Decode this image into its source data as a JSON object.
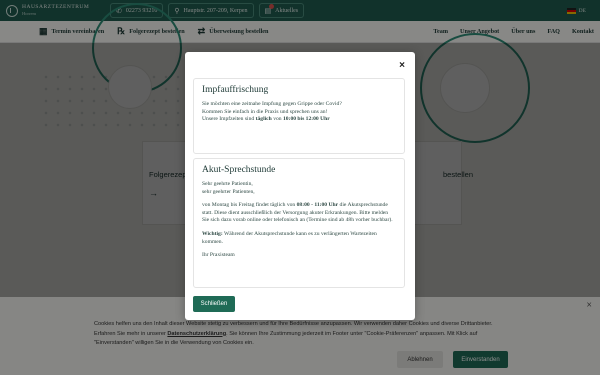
{
  "topbar": {
    "logo_main": "HAUSARZTEZENTRUM",
    "logo_sub": "Horrem",
    "phone": "02273 93210",
    "address": "Hauptstr. 207-209, Kerpen",
    "news": "Aktuelles",
    "lang": "DE"
  },
  "nav": {
    "items": [
      {
        "label": "Termin vereinbaren",
        "icon": "calendar-icon"
      },
      {
        "label": "Folgerezept bestellen",
        "icon": "prescription-icon"
      },
      {
        "label": "Überweisung bestellen",
        "icon": "referral-icon"
      }
    ],
    "right": [
      "Team",
      "Unser Angebot",
      "Über uns",
      "FAQ",
      "Kontakt"
    ]
  },
  "hero": {
    "card_left": "Folgerezep",
    "card_right": "bestellen",
    "arrow": "→"
  },
  "modal": {
    "close": "×",
    "section1_title": "Impfauffrischung",
    "section1_line1": "Sie möchten eine zeitnahe Impfung gegen Grippe oder Covid?",
    "section1_line2": "Kommen Sie einfach in die Praxis und sprechen uns an!",
    "section1_line3_pre": "Unsere Impfzeiten sind",
    "section1_line3_bold": "täglich",
    "section1_line3_mid": "von",
    "section1_line3_time": "10:00 bis 12:00 Uhr",
    "section2_title": "Akut-Sprechstunde",
    "section2_greet1": "Sehr geehrte Patientin,",
    "section2_greet2": "sehr geehrter Patienten,",
    "section2_body_pre": "von Montag bis Freitag findet täglich von",
    "section2_body_time": "08:00 - 11:00 Uhr",
    "section2_body_post": "die Akutsprechstunde statt. Diese dient ausschließlich der Versorgung akuter Erkrankungen. Bitte melden Sie sich dazu vorab online oder telefonisch an (Termine sind ab 48h vorher buchbar).",
    "section2_note_bold": "Wichtig:",
    "section2_note": "Während der Akutsprechstunde kann es zu verlängerten Wartezeiten kommen.",
    "section2_sign": "Ihr Praxisteam",
    "button": "Schließen"
  },
  "cookie": {
    "text_pre": "Cookies helfen uns den Inhalt dieser Website stetig zu verbessern und für Ihre Bedürfnisse anzupassen. Wir verwenden daher Cookies und diverse Drittanbieter. Erfahren Sie mehr in unserer",
    "link": "Datenschutzerklärung",
    "text_post": ". Sie können Ihre Zustimmung jederzeit im Footer unter \"Cookie-Präferenzen\" anpassen. Mit Klick auf \"Einverstanden\" willigen Sie in die Verwendung von Cookies ein.",
    "decline": "Ablehnen",
    "accept": "Einverstanden",
    "close": "×"
  }
}
